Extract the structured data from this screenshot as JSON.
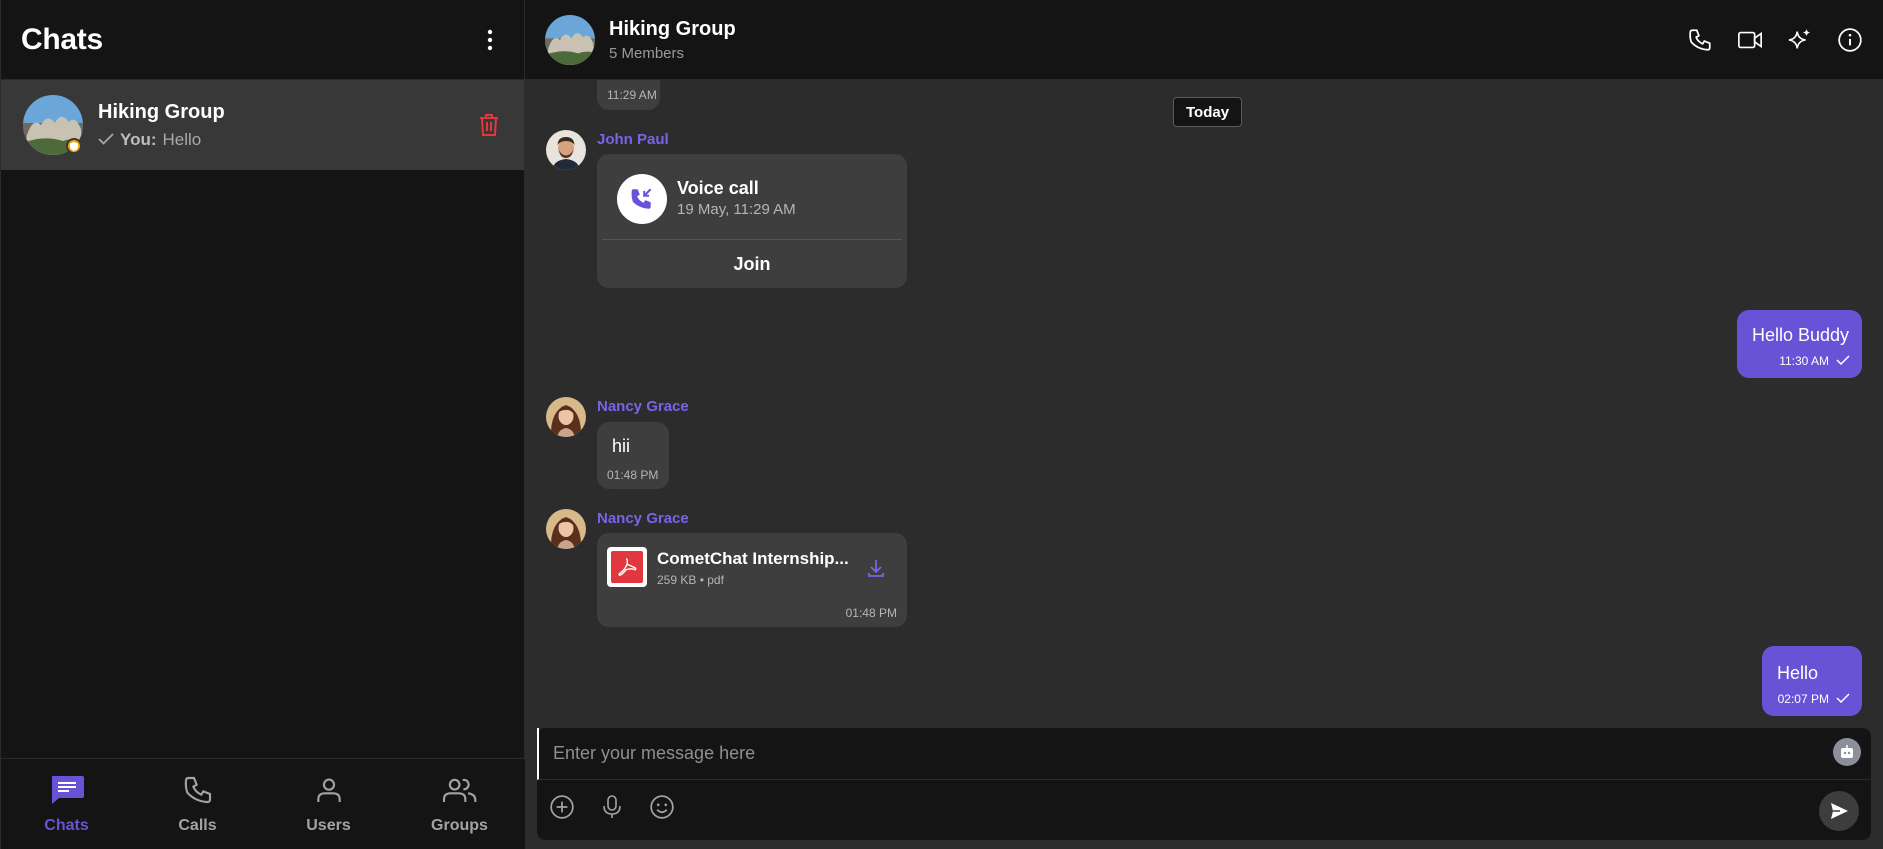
{
  "sidebar": {
    "title": "Chats",
    "conversation": {
      "name": "Hiking Group",
      "you_label": "You:",
      "last_message": "Hello"
    },
    "nav": [
      {
        "label": "Chats"
      },
      {
        "label": "Calls"
      },
      {
        "label": "Users"
      },
      {
        "label": "Groups"
      }
    ]
  },
  "header": {
    "name": "Hiking Group",
    "members": "5 Members"
  },
  "messages": {
    "prev_time": "11:29 AM",
    "date_separator": "Today",
    "call": {
      "sender": "John Paul",
      "title": "Voice call",
      "subtitle": "19 May, 11:29 AM",
      "join_label": "Join"
    },
    "out1": {
      "text": "Hello Buddy",
      "time": "11:30 AM"
    },
    "in1": {
      "sender": "Nancy Grace",
      "text": "hii",
      "time": "01:48 PM"
    },
    "file": {
      "sender": "Nancy Grace",
      "name": "CometChat Internship...",
      "meta": "259 KB • pdf",
      "time": "01:48 PM"
    },
    "out2": {
      "text": "Hello",
      "time": "02:07 PM"
    }
  },
  "composer": {
    "placeholder": "Enter your message here"
  },
  "colors": {
    "accent": "#6852d6",
    "danger": "#e0383e",
    "status": "#f0a818"
  }
}
